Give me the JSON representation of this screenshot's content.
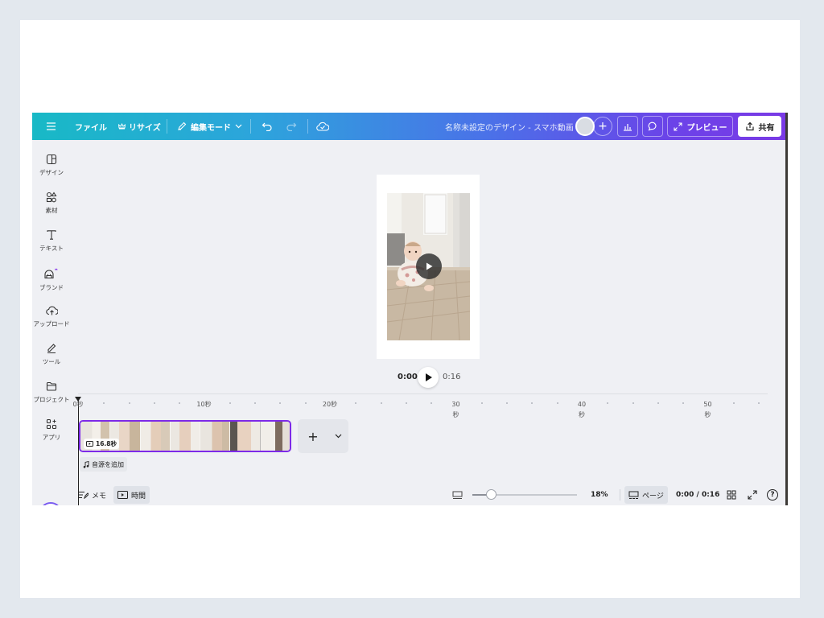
{
  "topbar": {
    "file_label": "ファイル",
    "resize_label": "リサイズ",
    "edit_mode_label": "編集モード",
    "doc_title": "名称未設定のデザイン - スマホ動画",
    "add_collaborator": "+",
    "preview_label": "プレビュー",
    "share_label": "共有"
  },
  "sidebar": {
    "items": [
      {
        "label": "デザイン",
        "icon": "design-icon"
      },
      {
        "label": "素材",
        "icon": "elements-icon"
      },
      {
        "label": "テキスト",
        "icon": "text-icon"
      },
      {
        "label": "ブランド",
        "icon": "brand-icon"
      },
      {
        "label": "アップロード",
        "icon": "upload-icon"
      },
      {
        "label": "ツール",
        "icon": "tools-icon"
      },
      {
        "label": "プロジェクト",
        "icon": "folder-icon"
      },
      {
        "label": "アプリ",
        "icon": "apps-icon"
      }
    ]
  },
  "playback": {
    "current": "0:00",
    "total": "0:16"
  },
  "timeline": {
    "ticks": [
      {
        "label": "0秒"
      },
      {
        "label": "10秒"
      },
      {
        "label": "20秒"
      },
      {
        "label": "30\n秒"
      },
      {
        "label": "40\n秒"
      },
      {
        "label": "50\n秒"
      }
    ],
    "clip_duration": "16.8秒",
    "add_clip": "+",
    "add_audio_label": "音源を追加"
  },
  "bottombar": {
    "notes_label": "メモ",
    "timing_label": "時間",
    "zoom_value": "18%",
    "zoom_fraction": 0.18,
    "pages_label": "ページ",
    "time_readout": "0:00 / 0:16",
    "help": "?"
  },
  "colors": {
    "gradient_start": "#18b9c6",
    "gradient_end": "#7a3ae6",
    "selection": "#7d2ae8"
  }
}
